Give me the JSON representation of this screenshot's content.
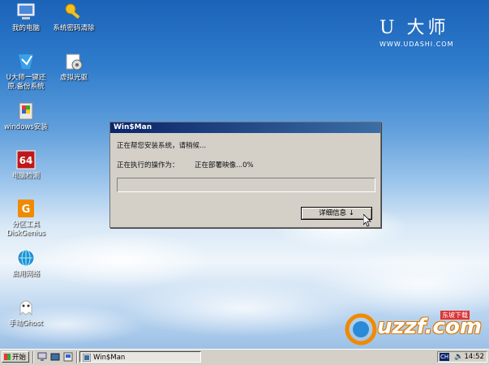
{
  "desktop": {
    "icons": [
      {
        "label": "我的电脑",
        "icon": "computer-icon"
      },
      {
        "label": "系统密码清除",
        "icon": "key-icon"
      },
      {
        "label": "U大师一键还\n原.备份系统",
        "icon": "restore-icon"
      },
      {
        "label": "虚拟光驱",
        "icon": "virtual-drive-icon"
      },
      {
        "label": "windows安装",
        "icon": "windows-setup-icon"
      },
      {
        "label": "电脑检测",
        "icon": "benchmark-icon"
      },
      {
        "label": "分区工具\nDiskGenius",
        "icon": "diskgenius-icon"
      },
      {
        "label": "启用网络",
        "icon": "network-icon"
      },
      {
        "label": "手动Ghost",
        "icon": "ghost-icon"
      }
    ],
    "brand": {
      "logo": "U 大师",
      "url": "WWW.UDASHI.COM"
    }
  },
  "dialog": {
    "title": "Win$Man",
    "status": "正在帮您安装系统，请稍候...",
    "operation_label": "正在执行的操作为：",
    "operation_value": "正在部署映像...0%",
    "progress": 0,
    "details_button": "详细信息 ↓"
  },
  "taskbar": {
    "start_label": "开始",
    "task_label": "Win$Man",
    "language": "CH",
    "time": "14:52"
  },
  "watermark": {
    "text": "uzzf.com",
    "tag": "东坡下载"
  }
}
